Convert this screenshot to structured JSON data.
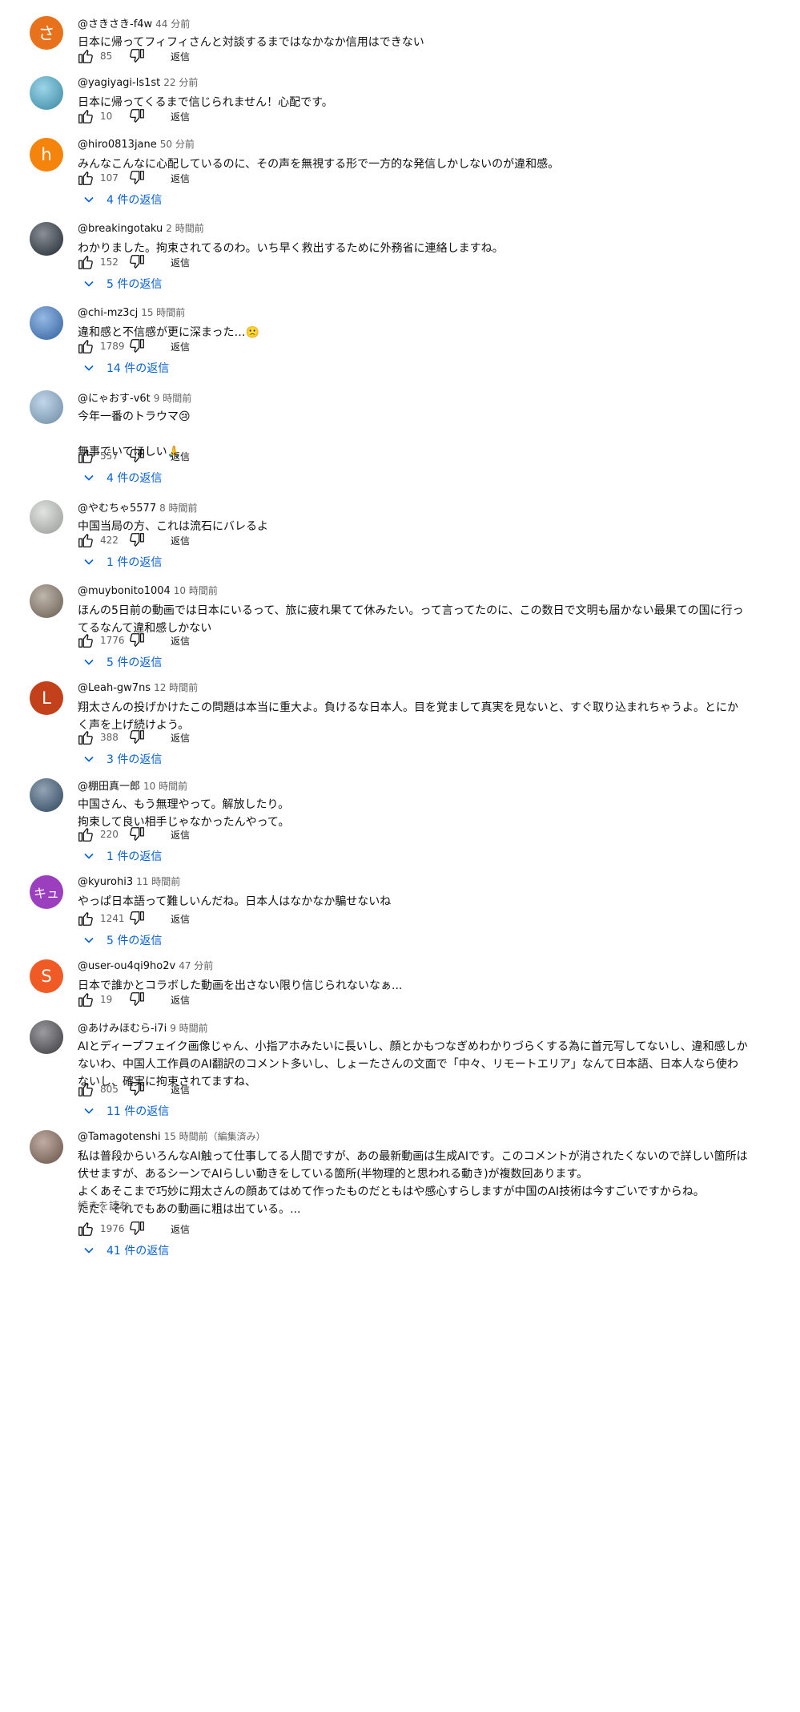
{
  "comments": [
    {
      "author": "@さきさき-f4w",
      "time": "44 分前",
      "lines": [
        "日本に帰ってフィフィさんと対談するまではなかなか信用はできない"
      ],
      "likes": "85",
      "reply": "返信",
      "replies": "",
      "avatar_letter": "さ",
      "avatar_color": "#e8711c",
      "avatar_type": "letter"
    },
    {
      "author": "@yagiyagi-ls1st",
      "time": "22 分前",
      "lines": [
        "日本に帰ってくるまで信じられません！心配です。"
      ],
      "likes": "10",
      "reply": "返信",
      "replies": "",
      "avatar_letter": "",
      "avatar_color": "#4ab3d6",
      "avatar_type": "image"
    },
    {
      "author": "@hiro0813jane",
      "time": "50 分前",
      "lines": [
        "みんなこんなに心配しているのに、その声を無視する形で一方的な発信しかしないのが違和感。"
      ],
      "likes": "107",
      "reply": "返信",
      "replies": "4 件の返信",
      "avatar_letter": "h",
      "avatar_color": "#f4840b",
      "avatar_type": "letter"
    },
    {
      "author": "@breakingotaku",
      "time": "2 時間前",
      "lines": [
        "わかりました。拘束されてるのわ。いち早く救出するために外務省に連絡しますね。"
      ],
      "likes": "152",
      "reply": "返信",
      "replies": "5 件の返信",
      "avatar_letter": "",
      "avatar_color": "#2b3440",
      "avatar_type": "image"
    },
    {
      "author": "@chi-mz3cj",
      "time": "15 時間前",
      "lines": [
        "違和感と不信感が更に深まった…🙁"
      ],
      "likes": "1789",
      "reply": "返信",
      "replies": "14 件の返信",
      "avatar_letter": "",
      "avatar_color": "#3f7fd0",
      "avatar_type": "image"
    },
    {
      "author": "@にゃおす-v6t",
      "time": "9 時間前",
      "lines": [
        "今年一番のトラウマ😢",
        "",
        "無事でいてほしい🙏"
      ],
      "likes": "557",
      "reply": "返信",
      "replies": "4 件の返信",
      "avatar_letter": "",
      "avatar_color": "#8fb6d8",
      "avatar_type": "image"
    },
    {
      "author": "@やむちゃ5577",
      "time": "8 時間前",
      "lines": [
        "中国当局の方、これは流石にバレるよ"
      ],
      "likes": "422",
      "reply": "返信",
      "replies": "1 件の返信",
      "avatar_letter": "",
      "avatar_color": "#c9ccc9",
      "avatar_type": "image"
    },
    {
      "author": "@muybonito1004",
      "time": "10 時間前",
      "lines": [
        "ほんの5日前の動画では日本にいるって、旅に疲れ果てて休みたい。って言ってたのに、この数日で文明も届かない最果ての国に行っ",
        "てるなんて違和感しかない"
      ],
      "likes": "1776",
      "reply": "返信",
      "replies": "5 件の返信",
      "avatar_letter": "",
      "avatar_color": "#8a7a68",
      "avatar_type": "image"
    },
    {
      "author": "@Leah-gw7ns",
      "time": "12 時間前",
      "lines": [
        "翔太さんの投げかけたこの問題は本当に重大よ。負けるな日本人。目を覚まして真実を見ないと、すぐ取り込まれちゃうよ。とにか",
        "く声を上げ続けよう。"
      ],
      "likes": "388",
      "reply": "返信",
      "replies": "3 件の返信",
      "avatar_letter": "L",
      "avatar_color": "#c2401a",
      "avatar_type": "letter"
    },
    {
      "author": "@棚田真一郎",
      "time": "10 時間前",
      "lines": [
        "中国さん、もう無理やって。解放したり。",
        "拘束して良い相手じゃなかったんやって。"
      ],
      "likes": "220",
      "reply": "返信",
      "replies": "1 件の返信",
      "avatar_letter": "",
      "avatar_color": "#3a5a78",
      "avatar_type": "image"
    },
    {
      "author": "@kyurohi3",
      "time": "11 時間前",
      "lines": [
        "やっぱ日本語って難しいんだね。日本人はなかなか騙せないね"
      ],
      "likes": "1241",
      "reply": "返信",
      "replies": "5 件の返信",
      "avatar_letter": "キュ",
      "avatar_color": "#9b3fbf",
      "avatar_type": "letter"
    },
    {
      "author": "@user-ou4qi9ho2v",
      "time": "47 分前",
      "lines": [
        "日本で誰かとコラボした動画を出さない限り信じられないなぁ..."
      ],
      "likes": "19",
      "reply": "返信",
      "replies": "",
      "avatar_letter": "S",
      "avatar_color": "#f05a24",
      "avatar_type": "letter"
    },
    {
      "author": "@あけみほむら-i7i",
      "time": "9 時間前",
      "lines": [
        "AIとディープフェイク画像じゃん、小指アホみたいに長いし、顔とかもつなぎめわかりづらくする為に首元写してないし、違和感しか",
        "ないわ、中国人工作員のAI翻訳のコメント多いし、しょーたさんの文面で「中々、リモートエリア」なんて日本語、日本人なら使わ",
        "ないし、確実に拘束されてますね、"
      ],
      "likes": "805",
      "reply": "返信",
      "replies": "11 件の返信",
      "avatar_letter": "",
      "avatar_color": "#4a4a52",
      "avatar_type": "image"
    },
    {
      "author": "@Tamagotenshi",
      "time": "15 時間前（編集済み）",
      "lines": [
        "私は普段からいろんなAI触って仕事してる人間ですが、あの最新動画は生成AIです。このコメントが消されたくないので詳しい箇所は",
        "伏せますが、あるシーンでAIらしい動きをしている箇所(半物理的と思われる動き)が複数回あります。",
        "よくあそこまで巧妙に翔太さんの顔あてはめて作ったものだともはや感心すらしますが中国のAI技術は今すごいですからね。",
        "ただ、それでもあの動画に粗は出ている。..."
      ],
      "likes": "1976",
      "reply": "返信",
      "replies": "41 件の返信",
      "read_more": "続きを読む",
      "avatar_letter": "",
      "avatar_color": "#8a6a5a",
      "avatar_type": "image"
    }
  ]
}
